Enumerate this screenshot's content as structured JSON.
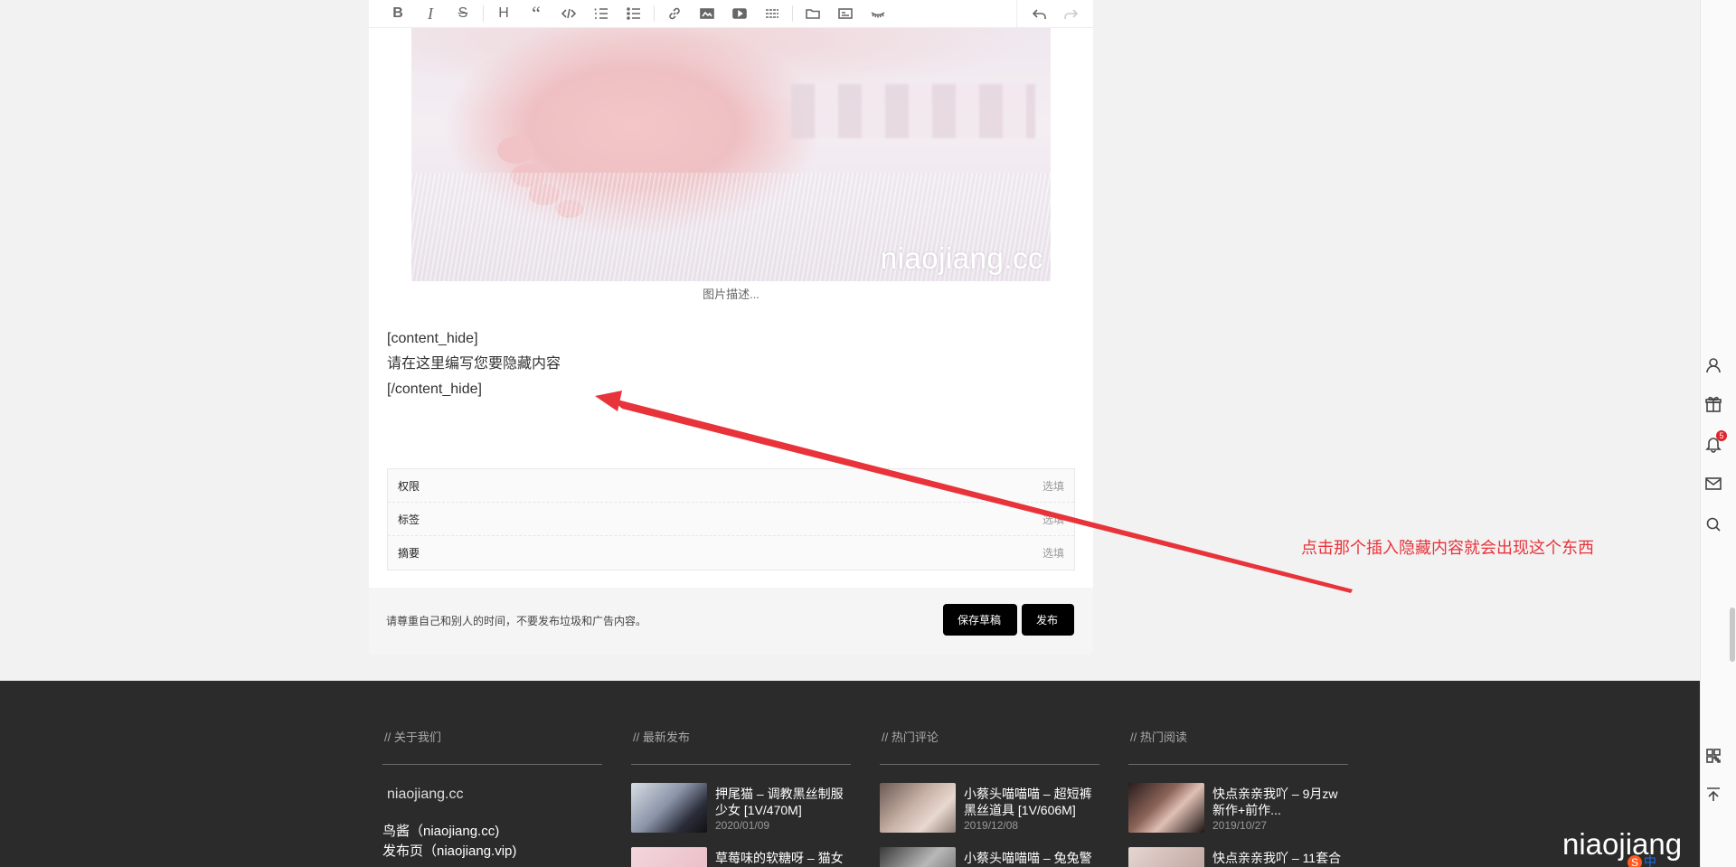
{
  "toolbar": {
    "buttons": [
      "bold",
      "italic",
      "strikethrough",
      "heading",
      "quote",
      "code",
      "ordered-list",
      "unordered-list",
      "link",
      "image",
      "video",
      "divider",
      "file",
      "card",
      "hide"
    ]
  },
  "editor": {
    "image_watermark": "niaojiang.cc",
    "image_caption": "图片描述...",
    "lines": [
      "[content_hide]",
      "请在这里编写您要隐藏内容",
      "[/content_hide]"
    ]
  },
  "meta": {
    "rows": [
      {
        "label": "权限",
        "hint": "选填"
      },
      {
        "label": "标签",
        "hint": "选填"
      },
      {
        "label": "摘要",
        "hint": "选填"
      }
    ]
  },
  "submit": {
    "note": "请尊重自己和别人的时间，不要发布垃圾和广告内容。",
    "draft_label": "保存草稿",
    "publish_label": "发布"
  },
  "annotation": {
    "text": "点击那个插入隐藏内容就会出现这个东西",
    "color": "#e8333a"
  },
  "rail": {
    "notification_count": "5"
  },
  "footer": {
    "about": {
      "title": "// 关于我们",
      "site": "niaojiang.cc",
      "links": [
        "鸟酱（niaojiang.cc)",
        "发布页（niaojiang.vip)"
      ]
    },
    "latest": {
      "title": "// 最新发布",
      "posts": [
        {
          "title": "押尾猫 – 调教黑丝制服少女 [1V/470M]",
          "date": "2020/01/09"
        },
        {
          "title": "草莓味的软糖呀 – 猫女"
        }
      ]
    },
    "hot_comments": {
      "title": "// 热门评论",
      "posts": [
        {
          "title": "小蔡头喵喵喵 – 超短裤黑丝道具 [1V/606M]",
          "date": "2019/12/08"
        },
        {
          "title": "小蔡头喵喵喵 – 兔兔警"
        }
      ]
    },
    "hot_reads": {
      "title": "// 热门阅读",
      "posts": [
        {
          "title": "快点亲亲我吖 – 9月zw新作+前作...",
          "date": "2019/10/27"
        },
        {
          "title": "快点亲亲我吖 – 11套合"
        }
      ]
    },
    "watermark": "niaojiang",
    "ime": "中"
  }
}
